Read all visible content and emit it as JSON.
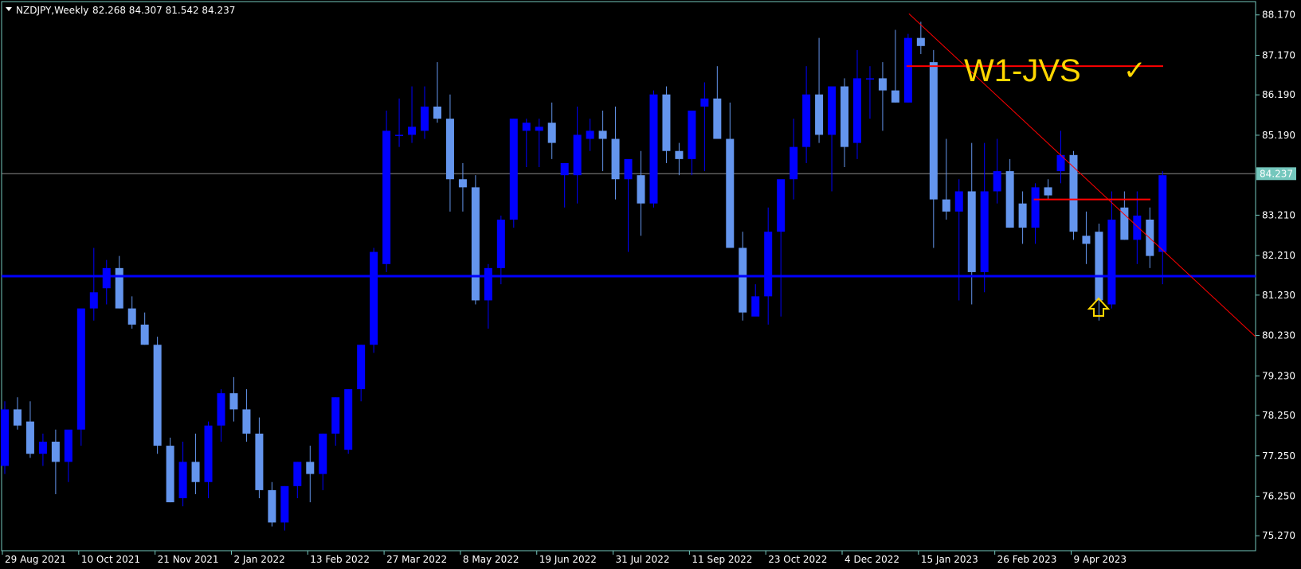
{
  "header": {
    "symbol_label": "NZDJPY,Weekly",
    "ohlc_label": "82.268 84.307 81.542 84.237"
  },
  "annotations": {
    "title_text": "W1-JVS",
    "check_mark": "✓",
    "arrow_icon": "up-arrow-icon"
  },
  "colors": {
    "background": "#000000",
    "frame": "#74c7bd",
    "bull": "#0000ff",
    "bear": "#6495ed",
    "trendline": "#ff0000",
    "support_line": "#0000ff",
    "annotation_text": "#ffd700",
    "price_badge": "#74c7bd"
  },
  "chart_data": {
    "type": "candlestick",
    "symbol": "NZDJPY",
    "timeframe": "Weekly",
    "y_ticks": [
      "88.170",
      "87.170",
      "86.190",
      "85.190",
      "84.237",
      "83.210",
      "82.210",
      "81.230",
      "80.230",
      "79.230",
      "78.250",
      "77.250",
      "76.250",
      "75.270"
    ],
    "x_ticks": [
      "29 Aug 2021",
      "10 Oct 2021",
      "21 Nov 2021",
      "2 Jan 2022",
      "13 Feb 2022",
      "27 Mar 2022",
      "8 May 2022",
      "19 Jun 2022",
      "31 Jul 2022",
      "11 Sep 2022",
      "23 Oct 2022",
      "4 Dec 2022",
      "15 Jan 2023",
      "26 Feb 2023",
      "9 Apr 2023"
    ],
    "ylim": [
      74.9,
      88.5
    ],
    "current_price": "84.237",
    "candles": [
      [
        77.0,
        78.6,
        76.8,
        78.4
      ],
      [
        78.4,
        78.7,
        77.9,
        78.0
      ],
      [
        78.1,
        78.6,
        77.2,
        77.3
      ],
      [
        77.3,
        77.8,
        77.0,
        77.6
      ],
      [
        77.6,
        77.9,
        76.3,
        77.1
      ],
      [
        77.1,
        77.7,
        76.6,
        77.9
      ],
      [
        77.9,
        78.5,
        77.5,
        80.9
      ],
      [
        80.9,
        82.4,
        80.6,
        81.3
      ],
      [
        81.4,
        82.1,
        81.0,
        81.9
      ],
      [
        81.9,
        82.2,
        80.9,
        80.9
      ],
      [
        80.9,
        81.2,
        80.4,
        80.5
      ],
      [
        80.5,
        80.8,
        80.0,
        80.0
      ],
      [
        80.0,
        80.2,
        77.3,
        77.5
      ],
      [
        77.5,
        77.7,
        76.1,
        76.1
      ],
      [
        76.2,
        77.6,
        76.0,
        77.1
      ],
      [
        77.1,
        77.8,
        76.3,
        76.6
      ],
      [
        76.6,
        78.1,
        76.2,
        78.0
      ],
      [
        78.0,
        78.9,
        77.6,
        78.8
      ],
      [
        78.8,
        79.2,
        78.1,
        78.4
      ],
      [
        78.4,
        78.9,
        77.6,
        77.8
      ],
      [
        77.8,
        78.2,
        76.2,
        76.4
      ],
      [
        76.4,
        76.6,
        75.5,
        75.6
      ],
      [
        75.6,
        76.5,
        75.4,
        76.5
      ],
      [
        76.5,
        77.1,
        76.2,
        77.1
      ],
      [
        77.1,
        77.5,
        76.1,
        76.8
      ],
      [
        76.8,
        77.8,
        76.4,
        77.8
      ],
      [
        77.8,
        78.7,
        77.5,
        78.7
      ],
      [
        77.4,
        78.9,
        77.3,
        78.9
      ],
      [
        78.9,
        80.0,
        78.6,
        80.0
      ],
      [
        80.0,
        82.4,
        79.8,
        82.3
      ],
      [
        82.0,
        85.8,
        81.8,
        85.3
      ],
      [
        85.2,
        86.1,
        84.9,
        85.2
      ],
      [
        85.2,
        86.4,
        85.0,
        85.4
      ],
      [
        85.3,
        86.4,
        85.1,
        85.9
      ],
      [
        85.9,
        87.0,
        85.5,
        85.6
      ],
      [
        85.6,
        86.2,
        83.3,
        84.1
      ],
      [
        84.1,
        84.5,
        83.3,
        83.9
      ],
      [
        83.9,
        84.2,
        81.0,
        81.1
      ],
      [
        81.1,
        82.0,
        80.4,
        81.9
      ],
      [
        81.9,
        83.2,
        81.5,
        83.1
      ],
      [
        83.1,
        85.6,
        82.9,
        85.6
      ],
      [
        85.3,
        85.6,
        84.4,
        85.5
      ],
      [
        85.3,
        85.6,
        84.4,
        85.4
      ],
      [
        85.5,
        86.0,
        84.6,
        85.0
      ],
      [
        84.2,
        84.5,
        83.4,
        84.5
      ],
      [
        84.2,
        85.9,
        83.5,
        85.2
      ],
      [
        85.1,
        85.6,
        84.8,
        85.3
      ],
      [
        85.3,
        85.8,
        84.3,
        85.1
      ],
      [
        85.1,
        85.9,
        83.6,
        84.1
      ],
      [
        84.1,
        84.5,
        82.3,
        84.6
      ],
      [
        84.2,
        84.8,
        82.7,
        83.5
      ],
      [
        83.5,
        86.3,
        83.4,
        86.2
      ],
      [
        86.2,
        86.4,
        84.5,
        84.8
      ],
      [
        84.8,
        85.0,
        84.2,
        84.6
      ],
      [
        84.6,
        85.8,
        84.2,
        85.8
      ],
      [
        85.9,
        86.5,
        84.3,
        86.1
      ],
      [
        86.1,
        86.9,
        85.6,
        85.1
      ],
      [
        85.1,
        86.0,
        82.5,
        82.4
      ],
      [
        82.4,
        82.8,
        80.6,
        80.8
      ],
      [
        80.7,
        81.5,
        80.8,
        81.2
      ],
      [
        81.2,
        83.4,
        80.5,
        82.8
      ],
      [
        82.8,
        83.6,
        80.7,
        84.1
      ],
      [
        84.1,
        85.6,
        83.6,
        84.9
      ],
      [
        84.9,
        86.9,
        84.5,
        86.2
      ],
      [
        86.2,
        87.6,
        85.0,
        85.2
      ],
      [
        85.2,
        86.1,
        83.8,
        86.4
      ],
      [
        86.4,
        86.6,
        84.4,
        84.9
      ],
      [
        85.0,
        87.3,
        84.6,
        86.6
      ],
      [
        86.6,
        86.9,
        85.6,
        86.6
      ],
      [
        86.6,
        87.0,
        85.3,
        86.3
      ],
      [
        86.3,
        87.8,
        86.0,
        86.0
      ],
      [
        86.0,
        87.7,
        86.0,
        87.6
      ],
      [
        87.6,
        88.0,
        87.2,
        87.4
      ],
      [
        87.0,
        87.3,
        82.4,
        83.6
      ],
      [
        83.6,
        85.1,
        83.1,
        83.3
      ],
      [
        83.3,
        84.1,
        81.1,
        83.8
      ],
      [
        83.8,
        85.0,
        81.0,
        81.8
      ],
      [
        81.8,
        85.0,
        81.3,
        83.8
      ],
      [
        83.8,
        85.1,
        83.5,
        84.3
      ],
      [
        84.3,
        84.6,
        82.9,
        82.9
      ],
      [
        83.5,
        83.8,
        82.5,
        82.9
      ],
      [
        82.9,
        84.0,
        82.5,
        83.9
      ],
      [
        83.9,
        84.1,
        83.6,
        83.7
      ],
      [
        84.3,
        85.3,
        84.0,
        84.7
      ],
      [
        84.7,
        84.8,
        82.6,
        82.8
      ],
      [
        82.7,
        83.3,
        82.0,
        82.5
      ],
      [
        82.8,
        83.0,
        80.6,
        81.1
      ],
      [
        81.0,
        83.8,
        80.9,
        83.1
      ],
      [
        83.4,
        83.8,
        82.6,
        82.6
      ],
      [
        82.6,
        83.8,
        82.0,
        83.2
      ],
      [
        83.1,
        83.4,
        81.9,
        82.2
      ],
      [
        82.3,
        84.3,
        81.5,
        84.2
      ]
    ]
  }
}
